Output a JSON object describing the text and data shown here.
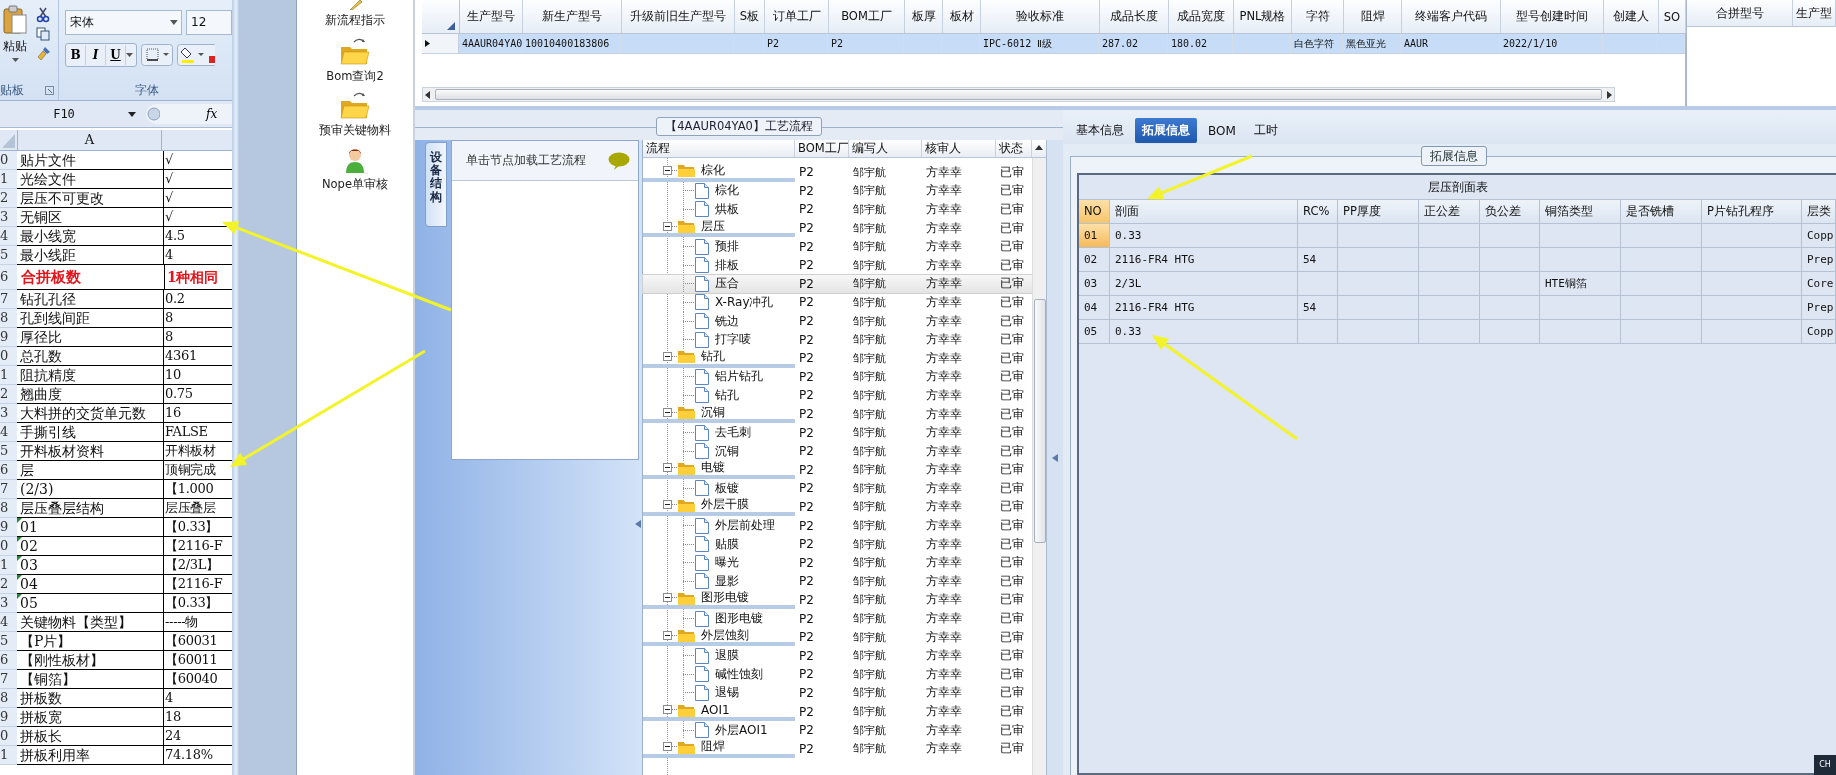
{
  "spreadsheet": {
    "ribbon": {
      "paste_label": "粘贴",
      "clipboard_group": "贴板",
      "font_group": "字体",
      "font_name": "宋体",
      "font_size": "12",
      "format_buttons": [
        "B",
        "I",
        "U"
      ]
    },
    "name_box": "F10",
    "formula_button": "fx",
    "column_header": "A",
    "rows": [
      {
        "num": "0",
        "a": "贴片文件",
        "b": "√",
        "kind": "normal",
        "flagged": false
      },
      {
        "num": "1",
        "a": "光绘文件",
        "b": "√",
        "kind": "normal",
        "flagged": false
      },
      {
        "num": "2",
        "a": "层压不可更改",
        "b": "√",
        "kind": "normal",
        "flagged": false
      },
      {
        "num": "3",
        "a": "无铜区",
        "b": "√",
        "kind": "normal",
        "flagged": false
      },
      {
        "num": "4",
        "a": "最小线宽",
        "b": "4.5",
        "kind": "normal",
        "flagged": false
      },
      {
        "num": "5",
        "a": "最小线距",
        "b": "4",
        "kind": "normal",
        "flagged": false
      },
      {
        "num": "6",
        "a": "合拼板数",
        "b": "1种相同",
        "kind": "emphasis",
        "flagged": false
      },
      {
        "num": "7",
        "a": "钻孔孔径",
        "b": "0.2",
        "kind": "normal",
        "flagged": false
      },
      {
        "num": "8",
        "a": "孔到线间距",
        "b": "8",
        "kind": "normal",
        "flagged": false
      },
      {
        "num": "9",
        "a": "厚径比",
        "b": "8",
        "kind": "normal",
        "flagged": false
      },
      {
        "num": "0",
        "a": "总孔数",
        "b": "4361",
        "kind": "normal",
        "flagged": false
      },
      {
        "num": "1",
        "a": "阻抗精度",
        "b": "10",
        "kind": "normal",
        "flagged": false
      },
      {
        "num": "2",
        "a": "翘曲度",
        "b": "0.75",
        "kind": "normal",
        "flagged": false
      },
      {
        "num": "3",
        "a": "大料拼的交货单元数",
        "b": "16",
        "kind": "normal",
        "flagged": false
      },
      {
        "num": "4",
        "a": "手撕引线",
        "b": "FALSE",
        "kind": "normal",
        "flagged": false
      },
      {
        "num": "5",
        "a": "开料板材资料",
        "b": "开料板材",
        "kind": "normal",
        "flagged": false
      },
      {
        "num": "6",
        "a": "层",
        "b": "顶铜完成",
        "kind": "normal",
        "flagged": false
      },
      {
        "num": "7",
        "a": "(2/3)",
        "b": "【1.000",
        "kind": "normal",
        "flagged": false
      },
      {
        "num": "8",
        "a": "层压叠层结构",
        "b": "层压叠层",
        "kind": "normal",
        "flagged": false
      },
      {
        "num": "9",
        "a": "01",
        "b": "【0.33】",
        "kind": "normal",
        "flagged": true
      },
      {
        "num": "0",
        "a": "02",
        "b": "【2116-F",
        "kind": "normal",
        "flagged": true
      },
      {
        "num": "1",
        "a": "03",
        "b": "【2/3L】",
        "kind": "normal",
        "flagged": true
      },
      {
        "num": "2",
        "a": "04",
        "b": "【2116-F",
        "kind": "normal",
        "flagged": true
      },
      {
        "num": "3",
        "a": "05",
        "b": "【0.33】",
        "kind": "normal",
        "flagged": true
      },
      {
        "num": "4",
        "a": "关键物料【类型】",
        "b": "-----物",
        "kind": "normal",
        "flagged": false
      },
      {
        "num": "5",
        "a": "【P片】",
        "b": "【60031",
        "kind": "normal",
        "flagged": false
      },
      {
        "num": "6",
        "a": "【刚性板材】",
        "b": "【60011",
        "kind": "normal",
        "flagged": false
      },
      {
        "num": "7",
        "a": "【铜箔】",
        "b": "【60040",
        "kind": "normal",
        "flagged": false
      },
      {
        "num": "8",
        "a": "拼板数",
        "b": "4",
        "kind": "normal",
        "flagged": false
      },
      {
        "num": "9",
        "a": "拼板宽",
        "b": "18",
        "kind": "normal",
        "flagged": false
      },
      {
        "num": "0",
        "a": "拼板长",
        "b": "24",
        "kind": "normal",
        "flagged": false
      },
      {
        "num": "1",
        "a": "拼板利用率",
        "b": "74.18%",
        "kind": "normal",
        "flagged": false
      }
    ]
  },
  "launcher": {
    "items": [
      {
        "label": "新流程指示",
        "kind": "pencil"
      },
      {
        "label": "Bom查询2",
        "kind": "folder"
      },
      {
        "label": "预审关键物料",
        "kind": "folder"
      },
      {
        "label": "Nope单审核",
        "kind": "user"
      }
    ]
  },
  "order_grid": {
    "columns": [
      "生产型号",
      "新生产型号",
      "升级前旧生产型号",
      "S板",
      "订单工厂",
      "BOM工厂",
      "板厚",
      "板材",
      "验收标准",
      "成品长度",
      "成品宽度",
      "PNL规格",
      "字符",
      "阻焊",
      "终端客户代码",
      "型号创建时间",
      "创建人",
      "SO"
    ],
    "rows": [
      {
        "selected": true,
        "cells": [
          "4AAUR04YA0",
          "10010400183806",
          "",
          "",
          "P2",
          "P2",
          "",
          "",
          "IPC-6012 Ⅱ级",
          "287.02",
          "180.02",
          "",
          "白色字符",
          "黑色亚光",
          "AAUR",
          "2022/1/10",
          "",
          ""
        ]
      }
    ]
  },
  "merge_grid": {
    "columns": [
      "合拼型号",
      "生产型"
    ]
  },
  "process": {
    "title": "【4AAUR04YA0】工艺流程",
    "side_tab": "设备结构",
    "hint": "单击节点加载工艺流程",
    "columns": [
      "流程",
      "BOM工厂",
      "编写人",
      "核审人",
      "状态"
    ],
    "nodes": [
      {
        "kind": "folder",
        "name": "棕化",
        "bom": "P2",
        "writer": "邹宇航",
        "reviewer": "方幸幸",
        "status": "已审",
        "expanded": true,
        "selected": false,
        "children": [
          {
            "kind": "step",
            "name": "棕化",
            "bom": "P2",
            "writer": "邹宇航",
            "reviewer": "方幸幸",
            "status": "已审",
            "selected": false
          },
          {
            "kind": "step",
            "name": "烘板",
            "bom": "P2",
            "writer": "邹宇航",
            "reviewer": "方幸幸",
            "status": "已审",
            "selected": false
          }
        ]
      },
      {
        "kind": "folder",
        "name": "层压",
        "bom": "P2",
        "writer": "邹宇航",
        "reviewer": "方幸幸",
        "status": "已审",
        "expanded": true,
        "selected": false,
        "children": [
          {
            "kind": "step",
            "name": "预排",
            "bom": "P2",
            "writer": "邹宇航",
            "reviewer": "方幸幸",
            "status": "已审",
            "selected": false
          },
          {
            "kind": "step",
            "name": "排板",
            "bom": "P2",
            "writer": "邹宇航",
            "reviewer": "方幸幸",
            "status": "已审",
            "selected": false
          },
          {
            "kind": "step",
            "name": "压合",
            "bom": "P2",
            "writer": "邹宇航",
            "reviewer": "方幸幸",
            "status": "已审",
            "selected": true
          },
          {
            "kind": "step",
            "name": "X-Ray冲孔",
            "bom": "P2",
            "writer": "邹宇航",
            "reviewer": "方幸幸",
            "status": "已审",
            "selected": false
          },
          {
            "kind": "step",
            "name": "铣边",
            "bom": "P2",
            "writer": "邹宇航",
            "reviewer": "方幸幸",
            "status": "已审",
            "selected": false
          },
          {
            "kind": "step",
            "name": "打字唛",
            "bom": "P2",
            "writer": "邹宇航",
            "reviewer": "方幸幸",
            "status": "已审",
            "selected": false
          }
        ]
      },
      {
        "kind": "folder",
        "name": "钻孔",
        "bom": "P2",
        "writer": "邹宇航",
        "reviewer": "方幸幸",
        "status": "已审",
        "expanded": true,
        "selected": false,
        "children": [
          {
            "kind": "step",
            "name": "铝片钻孔",
            "bom": "P2",
            "writer": "邹宇航",
            "reviewer": "方幸幸",
            "status": "已审",
            "selected": false
          },
          {
            "kind": "step",
            "name": "钻孔",
            "bom": "P2",
            "writer": "邹宇航",
            "reviewer": "方幸幸",
            "status": "已审",
            "selected": false
          }
        ]
      },
      {
        "kind": "folder",
        "name": "沉铜",
        "bom": "P2",
        "writer": "邹宇航",
        "reviewer": "方幸幸",
        "status": "已审",
        "expanded": true,
        "selected": false,
        "children": [
          {
            "kind": "step",
            "name": "去毛刺",
            "bom": "P2",
            "writer": "邹宇航",
            "reviewer": "方幸幸",
            "status": "已审",
            "selected": false
          },
          {
            "kind": "step",
            "name": "沉铜",
            "bom": "P2",
            "writer": "邹宇航",
            "reviewer": "方幸幸",
            "status": "已审",
            "selected": false
          }
        ]
      },
      {
        "kind": "folder",
        "name": "电镀",
        "bom": "P2",
        "writer": "邹宇航",
        "reviewer": "方幸幸",
        "status": "已审",
        "expanded": true,
        "selected": false,
        "children": [
          {
            "kind": "step",
            "name": "板镀",
            "bom": "P2",
            "writer": "邹宇航",
            "reviewer": "方幸幸",
            "status": "已审",
            "selected": false
          }
        ]
      },
      {
        "kind": "folder",
        "name": "外层干膜",
        "bom": "P2",
        "writer": "邹宇航",
        "reviewer": "方幸幸",
        "status": "已审",
        "expanded": true,
        "selected": false,
        "children": [
          {
            "kind": "step",
            "name": "外层前处理",
            "bom": "P2",
            "writer": "邹宇航",
            "reviewer": "方幸幸",
            "status": "已审",
            "selected": false
          },
          {
            "kind": "step",
            "name": "贴膜",
            "bom": "P2",
            "writer": "邹宇航",
            "reviewer": "方幸幸",
            "status": "已审",
            "selected": false
          },
          {
            "kind": "step",
            "name": "曝光",
            "bom": "P2",
            "writer": "邹宇航",
            "reviewer": "方幸幸",
            "status": "已审",
            "selected": false
          },
          {
            "kind": "step",
            "name": "显影",
            "bom": "P2",
            "writer": "邹宇航",
            "reviewer": "方幸幸",
            "status": "已审",
            "selected": false
          }
        ]
      },
      {
        "kind": "folder",
        "name": "图形电镀",
        "bom": "P2",
        "writer": "邹宇航",
        "reviewer": "方幸幸",
        "status": "已审",
        "expanded": true,
        "selected": false,
        "children": [
          {
            "kind": "step",
            "name": "图形电镀",
            "bom": "P2",
            "writer": "邹宇航",
            "reviewer": "方幸幸",
            "status": "已审",
            "selected": false
          }
        ]
      },
      {
        "kind": "folder",
        "name": "外层蚀刻",
        "bom": "P2",
        "writer": "邹宇航",
        "reviewer": "方幸幸",
        "status": "已审",
        "expanded": true,
        "selected": false,
        "children": [
          {
            "kind": "step",
            "name": "退膜",
            "bom": "P2",
            "writer": "邹宇航",
            "reviewer": "方幸幸",
            "status": "已审",
            "selected": false
          },
          {
            "kind": "step",
            "name": "碱性蚀刻",
            "bom": "P2",
            "writer": "邹宇航",
            "reviewer": "方幸幸",
            "status": "已审",
            "selected": false
          },
          {
            "kind": "step",
            "name": "退锡",
            "bom": "P2",
            "writer": "邹宇航",
            "reviewer": "方幸幸",
            "status": "已审",
            "selected": false
          }
        ]
      },
      {
        "kind": "folder",
        "name": "AOI1",
        "bom": "P2",
        "writer": "邹宇航",
        "reviewer": "方幸幸",
        "status": "已审",
        "expanded": true,
        "selected": false,
        "children": [
          {
            "kind": "step",
            "name": "外层AOI1",
            "bom": "P2",
            "writer": "邹宇航",
            "reviewer": "方幸幸",
            "status": "已审",
            "selected": false
          }
        ]
      },
      {
        "kind": "folder",
        "name": "阻焊",
        "bom": "P2",
        "writer": "邹宇航",
        "reviewer": "方幸幸",
        "status": "已审",
        "expanded": true,
        "selected": false
      }
    ]
  },
  "detail": {
    "tabs": [
      {
        "label": "基本信息",
        "selected": false
      },
      {
        "label": "拓展信息",
        "selected": true
      },
      {
        "label": "BOM",
        "selected": false
      },
      {
        "label": "工时",
        "selected": false
      }
    ],
    "group_title": "拓展信息",
    "table": {
      "title": "层压剖面表",
      "columns": [
        "NO",
        "剖面",
        "RC%",
        "PP厚度",
        "正公差",
        "负公差",
        "铜箔类型",
        "是否铣槽",
        "P片钻孔程序",
        "层类"
      ],
      "rows": [
        {
          "selected": true,
          "cells": [
            "01",
            "0.33",
            "",
            "",
            "",
            "",
            "",
            "",
            "",
            "Copp"
          ]
        },
        {
          "selected": false,
          "cells": [
            "02",
            "2116-FR4 HTG",
            "54",
            "",
            "",
            "",
            "",
            "",
            "",
            "Prep"
          ]
        },
        {
          "selected": false,
          "cells": [
            "03",
            "2/3L",
            "",
            "",
            "",
            "",
            "HTE铜箔",
            "",
            "",
            "Core"
          ]
        },
        {
          "selected": false,
          "cells": [
            "04",
            "2116-FR4 HTG",
            "54",
            "",
            "",
            "",
            "",
            "",
            "",
            "Prep"
          ]
        },
        {
          "selected": false,
          "cells": [
            "05",
            "0.33",
            "",
            "",
            "",
            "",
            "",
            "",
            "",
            "Copp"
          ]
        }
      ]
    }
  },
  "tray": {
    "label": "CH"
  }
}
